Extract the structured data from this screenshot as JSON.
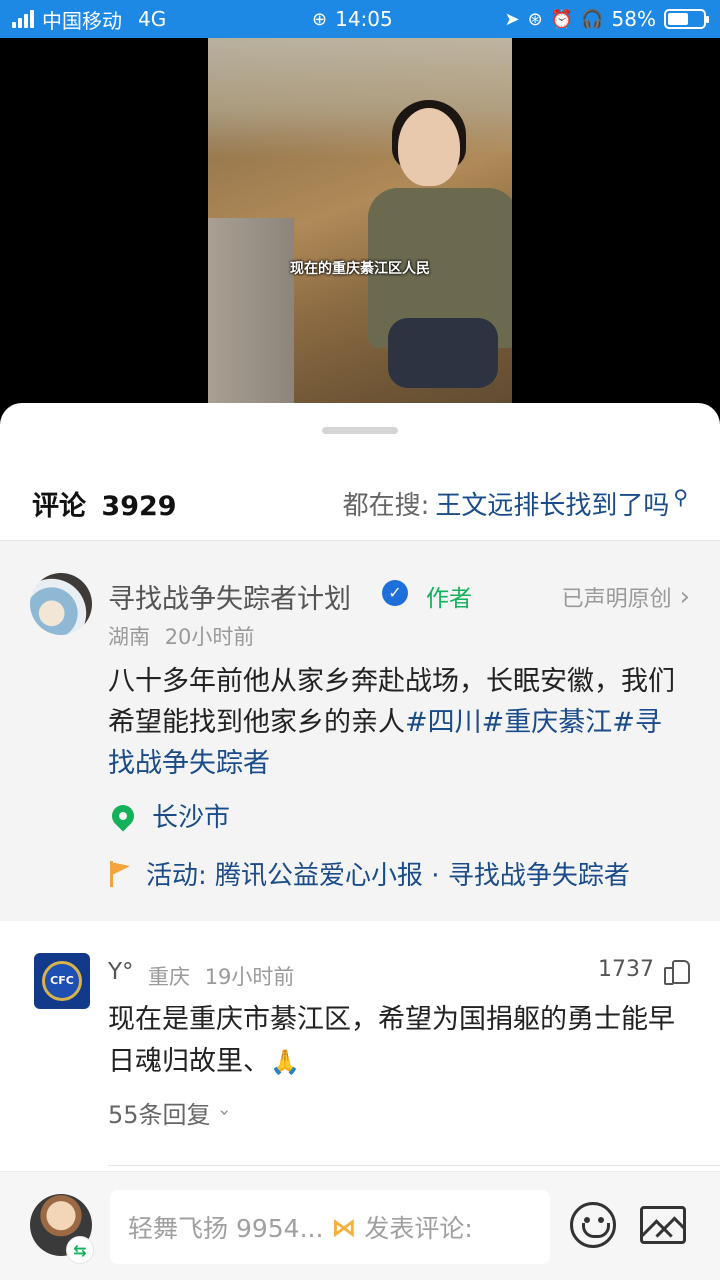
{
  "status_bar": {
    "carrier": "中国移动",
    "network": "4G",
    "time": "14:05",
    "battery": "58%",
    "battery_level": 0.58
  },
  "video": {
    "caption": "现在的重庆綦江区人民"
  },
  "comments_header": {
    "title": "评论",
    "count": "3929",
    "search_label": "都在搜:",
    "search_term": "王文远排长找到了吗"
  },
  "author_post": {
    "name": "寻找战争失踪者计划",
    "author_tag": "作者",
    "original_label": "已声明原创",
    "region": "湖南",
    "time": "20小时前",
    "text_plain": "八十多年前他从家乡奔赴战场，长眠安徽，我们希望能找到他家乡的亲人",
    "tags": [
      "#四川",
      "#重庆綦江",
      "#寻找战争失踪者"
    ],
    "location": "长沙市",
    "activity": "活动: 腾讯公益爱心小报 · 寻找战争失踪者"
  },
  "comment": {
    "user": "Y°",
    "region": "重庆",
    "time": "19小时前",
    "likes": "1737",
    "text": "现在是重庆市綦江区，希望为国捐躯的勇士能早日魂归故里、",
    "emoji": "🙏",
    "replies": "55条回复"
  },
  "bottom_bar": {
    "username": "轻舞飞扬 9954...",
    "input_placeholder": "发表评论:"
  },
  "colors": {
    "status_bar_bg": "#1e88e5",
    "link_blue": "#1b4c8a",
    "author_green": "#12b15a",
    "activity_orange": "#f5a33c"
  },
  "icons": [
    "signal-icon",
    "alarm-icon",
    "location-arrow-icon",
    "headphones-icon",
    "battery-icon",
    "verified-icon",
    "chevron-right-icon",
    "search-icon",
    "location-pin-icon",
    "flag-icon",
    "thumbs-up-icon",
    "chevron-down-icon",
    "emoji-icon",
    "image-icon"
  ]
}
